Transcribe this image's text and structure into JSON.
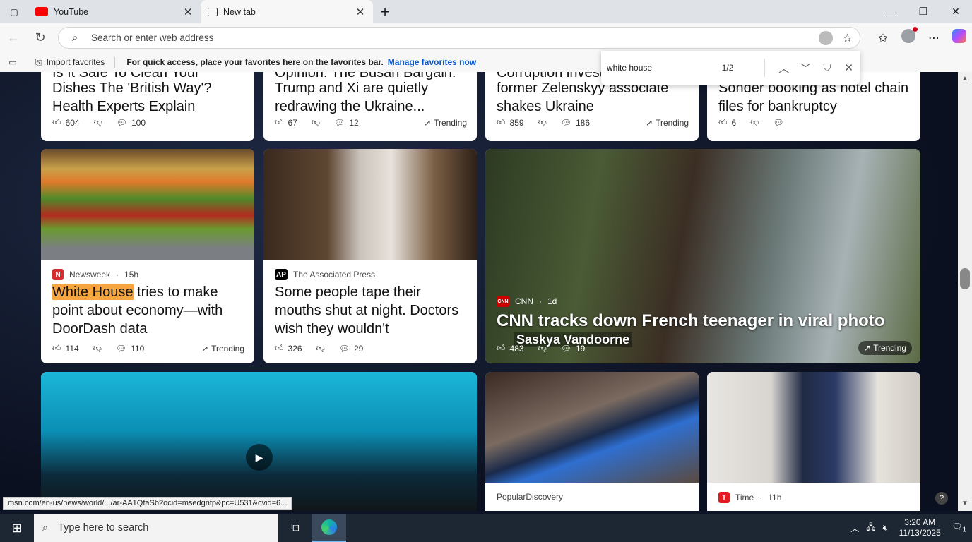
{
  "browser": {
    "tabs": [
      {
        "title": "YouTube",
        "icon": "youtube-icon",
        "active": false
      },
      {
        "title": "New tab",
        "icon": "newtab-icon",
        "active": true
      }
    ],
    "address_placeholder": "Search or enter web address",
    "favorites_bar": {
      "import_label": "Import favorites",
      "hint": "For quick access, place your favorites here on the favorites bar.",
      "manage_link": "Manage favorites now"
    },
    "find": {
      "query": "white house",
      "count": "1/2"
    },
    "status_url": "msn.com/en-us/news/world/.../ar-AA1QfaSb?ocid=msedgntp&pc=U531&cvid=6..."
  },
  "feed": {
    "top_row": [
      {
        "headline_line1": "Is It Safe To Clean Your",
        "headline": "Dishes The 'British Way'? Health Experts Explain",
        "likes": "604",
        "comments": "100",
        "trending": ""
      },
      {
        "headline_line1": "Opinion: The Busan Bargain:",
        "headline": "Trump and Xi are quietly redrawing the Ukraine...",
        "likes": "67",
        "comments": "12",
        "trending": "Trending"
      },
      {
        "headline_line1": "Corruption investigation",
        "headline": "former Zelenskyy associate shakes Ukraine",
        "likes": "859",
        "comments": "186",
        "trending": "Trending"
      },
      {
        "headline_line1": "",
        "headline": "Sonder booking as hotel chain files for bankruptcy",
        "likes": "6",
        "comments": "",
        "trending": ""
      }
    ],
    "middle_row": [
      {
        "source": "Newsweek",
        "age": "15h",
        "badge": "N",
        "badge_color": "#d32f2f",
        "headline_highlight": "White House",
        "headline_rest": " tries to make point about economy—with DoorDash data",
        "likes": "114",
        "comments": "110",
        "trending": "Trending"
      },
      {
        "source": "The Associated Press",
        "age": "",
        "badge": "AP",
        "badge_color": "#000000",
        "headline": "Some people tape their mouths shut at night. Doctors wish they wouldn't",
        "likes": "326",
        "comments": "29",
        "trending": ""
      },
      {
        "source": "CNN",
        "age": "1d",
        "badge": "CNN",
        "badge_color": "#cc0000",
        "headline": "CNN tracks down French teenager in viral photo",
        "caption": "Saskya Vandoorne",
        "likes": "483",
        "comments": "19",
        "trending": "Trending"
      }
    ],
    "bottom_row": [
      {
        "source": "",
        "play": true
      },
      {
        "source": "PopularDiscovery",
        "age": ""
      },
      {
        "source": "Time",
        "age": "11h",
        "badge": "T",
        "badge_color": "#e11b22"
      }
    ]
  },
  "taskbar": {
    "search_placeholder": "Type here to search",
    "time": "3:20 AM",
    "date": "11/13/2025",
    "notifications": "1"
  }
}
